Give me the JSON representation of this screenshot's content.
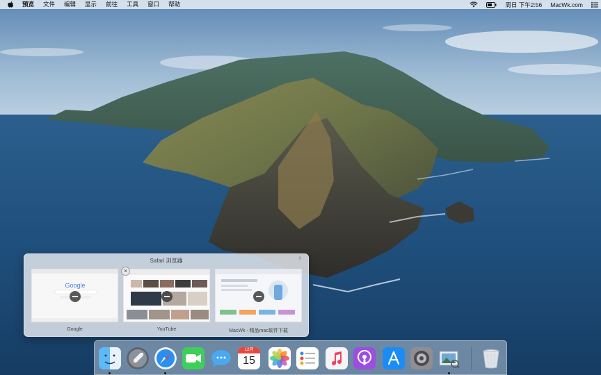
{
  "menubar": {
    "apple_icon": "apple-logo-icon",
    "items": [
      "预览",
      "文件",
      "编辑",
      "显示",
      "前往",
      "工具",
      "窗口",
      "帮助"
    ],
    "status": {
      "wifi_icon": "wifi-icon",
      "battery_icon": "battery-icon",
      "clock": "周日 下午2:56",
      "site": "MacWk.com",
      "list_icon": "notification-list-icon"
    }
  },
  "switcher": {
    "title": "Safari 浏览器",
    "windows": [
      {
        "label": "Google",
        "logo": "Google"
      },
      {
        "label": "YouTube"
      },
      {
        "label": "MacWk - 精品mac软件下载"
      }
    ]
  },
  "dock": {
    "items": [
      {
        "name": "finder",
        "running": true
      },
      {
        "name": "launchpad",
        "running": false
      },
      {
        "name": "safari",
        "running": true
      },
      {
        "name": "facetime",
        "running": false
      },
      {
        "name": "messages",
        "running": false
      },
      {
        "name": "calendar",
        "running": false,
        "month": "12月",
        "day": "15"
      },
      {
        "name": "photos",
        "running": false
      },
      {
        "name": "reminders",
        "running": false
      },
      {
        "name": "music",
        "running": false
      },
      {
        "name": "podcasts",
        "running": false
      },
      {
        "name": "app-store",
        "running": false
      },
      {
        "name": "system-preferences",
        "running": false
      },
      {
        "name": "preview",
        "running": true
      },
      {
        "name": "trash",
        "running": false
      }
    ]
  }
}
